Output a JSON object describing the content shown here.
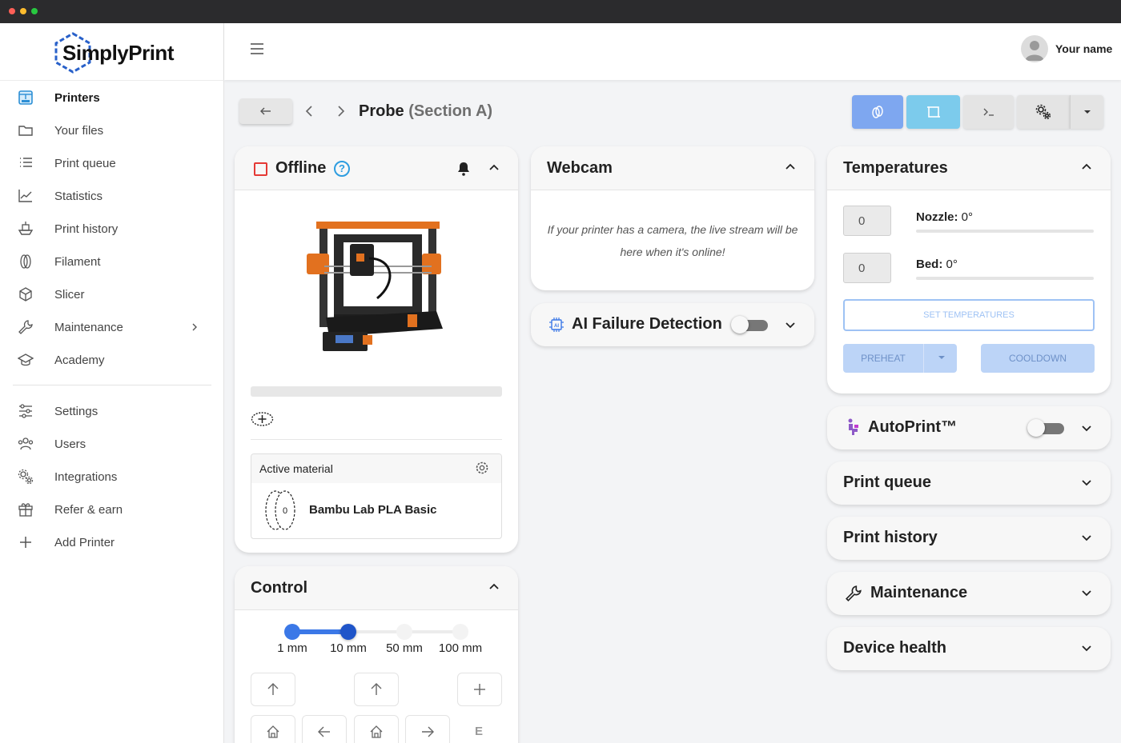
{
  "app": {
    "name": "SimplyPrint"
  },
  "sidebar": {
    "items": [
      {
        "label": "Printers",
        "icon": "printer-icon",
        "active": true
      },
      {
        "label": "Your files",
        "icon": "folder-icon"
      },
      {
        "label": "Print queue",
        "icon": "list-icon"
      },
      {
        "label": "Statistics",
        "icon": "chart-line-icon"
      },
      {
        "label": "Print history",
        "icon": "boat-icon"
      },
      {
        "label": "Filament",
        "icon": "filament-spool-icon"
      },
      {
        "label": "Slicer",
        "icon": "cube-icon"
      },
      {
        "label": "Maintenance",
        "icon": "wrench-icon",
        "has_submenu": true
      },
      {
        "label": "Academy",
        "icon": "graduation-cap-icon"
      }
    ],
    "bottom_items": [
      {
        "label": "Settings",
        "icon": "sliders-icon"
      },
      {
        "label": "Users",
        "icon": "users-icon"
      },
      {
        "label": "Integrations",
        "icon": "gears-icon"
      },
      {
        "label": "Refer & earn",
        "icon": "gift-icon"
      },
      {
        "label": "Add Printer",
        "icon": "plus-icon"
      }
    ]
  },
  "header": {
    "user_name": "Your name"
  },
  "page": {
    "printer_name": "Probe",
    "section": "(Section A)"
  },
  "status_card": {
    "status": "Offline",
    "help": "?",
    "active_material_title": "Active material",
    "material_name": "Bambu Lab PLA Basic",
    "spool_label": "0"
  },
  "webcam": {
    "title": "Webcam",
    "message": "If your printer has a camera, the live stream will be here when it's online!"
  },
  "ai_failure": {
    "title": "AI Failure Detection",
    "enabled": false
  },
  "temperatures": {
    "title": "Temperatures",
    "nozzle": {
      "label": "Nozzle:",
      "value": "0°",
      "input": "0"
    },
    "bed": {
      "label": "Bed:",
      "value": "0°",
      "input": "0"
    },
    "set_button": "SET TEMPERATURES",
    "preheat_button": "PREHEAT",
    "cooldown_button": "COOLDOWN"
  },
  "autoprint": {
    "title": "AutoPrint™",
    "enabled": false
  },
  "collapsed_panels": [
    {
      "title": "Print queue"
    },
    {
      "title": "Print history"
    },
    {
      "title": "Maintenance",
      "icon": "wrench-icon"
    },
    {
      "title": "Device health"
    }
  ],
  "control": {
    "title": "Control",
    "steps": [
      "1 mm",
      "10 mm",
      "50 mm",
      "100 mm"
    ],
    "selected_step": "10 mm",
    "extruder_label": "E"
  },
  "colors": {
    "accent_blue": "#3b78e7",
    "offline_red": "#e53935",
    "help_blue": "#2d9de0",
    "toolbar_blue": "#7ea7f0",
    "toolbar_cyan": "#7ccbec",
    "autoprint_purple": "#8e5ac8"
  }
}
